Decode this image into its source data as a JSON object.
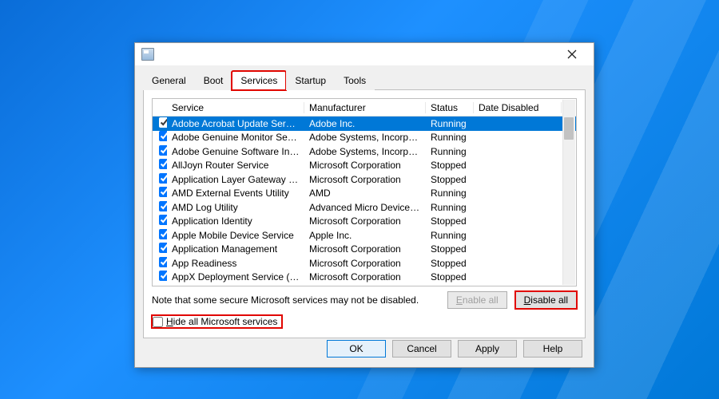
{
  "tabs": [
    "General",
    "Boot",
    "Services",
    "Startup",
    "Tools"
  ],
  "activeTab": 2,
  "columns": [
    "Service",
    "Manufacturer",
    "Status",
    "Date Disabled"
  ],
  "rows": [
    {
      "c": true,
      "sel": true,
      "svc": "Adobe Acrobat Update Service",
      "mfr": "Adobe Inc.",
      "st": "Running",
      "dd": ""
    },
    {
      "c": true,
      "svc": "Adobe Genuine Monitor Service",
      "mfr": "Adobe Systems, Incorpora...",
      "st": "Running",
      "dd": ""
    },
    {
      "c": true,
      "svc": "Adobe Genuine Software Integri...",
      "mfr": "Adobe Systems, Incorpora...",
      "st": "Running",
      "dd": ""
    },
    {
      "c": true,
      "svc": "AllJoyn Router Service",
      "mfr": "Microsoft Corporation",
      "st": "Stopped",
      "dd": ""
    },
    {
      "c": true,
      "svc": "Application Layer Gateway Service",
      "mfr": "Microsoft Corporation",
      "st": "Stopped",
      "dd": ""
    },
    {
      "c": true,
      "svc": "AMD External Events Utility",
      "mfr": "AMD",
      "st": "Running",
      "dd": ""
    },
    {
      "c": true,
      "svc": "AMD Log Utility",
      "mfr": "Advanced Micro Devices, I...",
      "st": "Running",
      "dd": ""
    },
    {
      "c": true,
      "svc": "Application Identity",
      "mfr": "Microsoft Corporation",
      "st": "Stopped",
      "dd": ""
    },
    {
      "c": true,
      "svc": "Apple Mobile Device Service",
      "mfr": "Apple Inc.",
      "st": "Running",
      "dd": ""
    },
    {
      "c": true,
      "svc": "Application Management",
      "mfr": "Microsoft Corporation",
      "st": "Stopped",
      "dd": ""
    },
    {
      "c": true,
      "svc": "App Readiness",
      "mfr": "Microsoft Corporation",
      "st": "Stopped",
      "dd": ""
    },
    {
      "c": true,
      "svc": "AppX Deployment Service (AppX...",
      "mfr": "Microsoft Corporation",
      "st": "Stopped",
      "dd": ""
    }
  ],
  "note": "Note that some secure Microsoft services may not be disabled.",
  "enableAll": "Enable all",
  "disableAll": "Disable all",
  "hideLabel_pre": "H",
  "hideLabel_rest": "ide all Microsoft services",
  "ok": "OK",
  "cancel": "Cancel",
  "apply": "Apply",
  "help": "Help"
}
